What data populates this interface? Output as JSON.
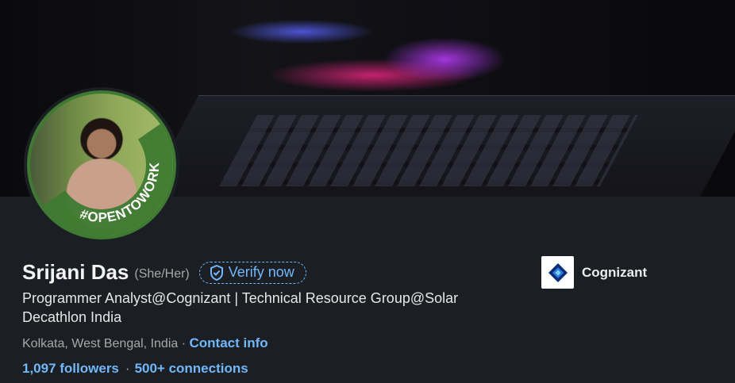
{
  "profile": {
    "name": "Srijani Das",
    "pronouns": "(She/Her)",
    "verify_label": "Verify now",
    "headline": "Programmer Analyst@Cognizant | Technical Resource Group@Solar Decathlon India",
    "location": "Kolkata, West Bengal, India",
    "location_separator": " · ",
    "contact_label": "Contact info",
    "followers": "1,097 followers",
    "stats_separator": "·",
    "connections": "500+ connections",
    "open_to_work_badge": "#OPENTOWORK"
  },
  "company": {
    "name": "Cognizant",
    "logo_icon": "cognizant-logo-icon"
  },
  "colors": {
    "background": "#1b1f23",
    "link": "#71b7fb",
    "open_to_work": "#3e7a32",
    "secondary_text": "#a8a8a8"
  }
}
